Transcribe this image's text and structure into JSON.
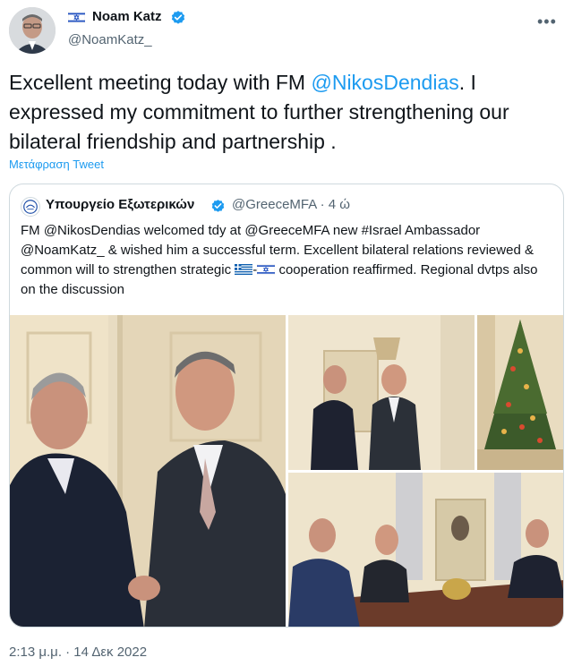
{
  "author": {
    "name": "Noam Katz",
    "handle": "@NoamKatz_",
    "flag_icon": "israel-flag-icon",
    "verified_color": "#1d9bf0"
  },
  "tweet": {
    "text_before": "Excellent meeting today with FM ",
    "mention": "@NikosDendias",
    "text_after": ". I expressed my commitment to further strengthening our bilateral friendship and partnership .",
    "translate_label": "Μετάφραση Tweet"
  },
  "quoted": {
    "name": "Υπουργείο Εξωτερικών",
    "handle": "@GreeceMFA",
    "separator": "·",
    "time": "4 ώ",
    "text_part1": "FM @NikosDendias welcomed tdy at @GreeceMFA new #Israel Ambassador @NoamKatz_ & wished him a successful term. Excellent bilateral relations reviewed & common will to strengthen strategic ",
    "text_dash": "-",
    "text_part2": " cooperation reaffirmed. Regional dvtps also on the discussion"
  },
  "timestamp": "2:13 μ.μ. · 14 Δεκ 2022",
  "colors": {
    "accent": "#1d9bf0",
    "secondary_text": "#536471",
    "border": "#cfd9de"
  }
}
